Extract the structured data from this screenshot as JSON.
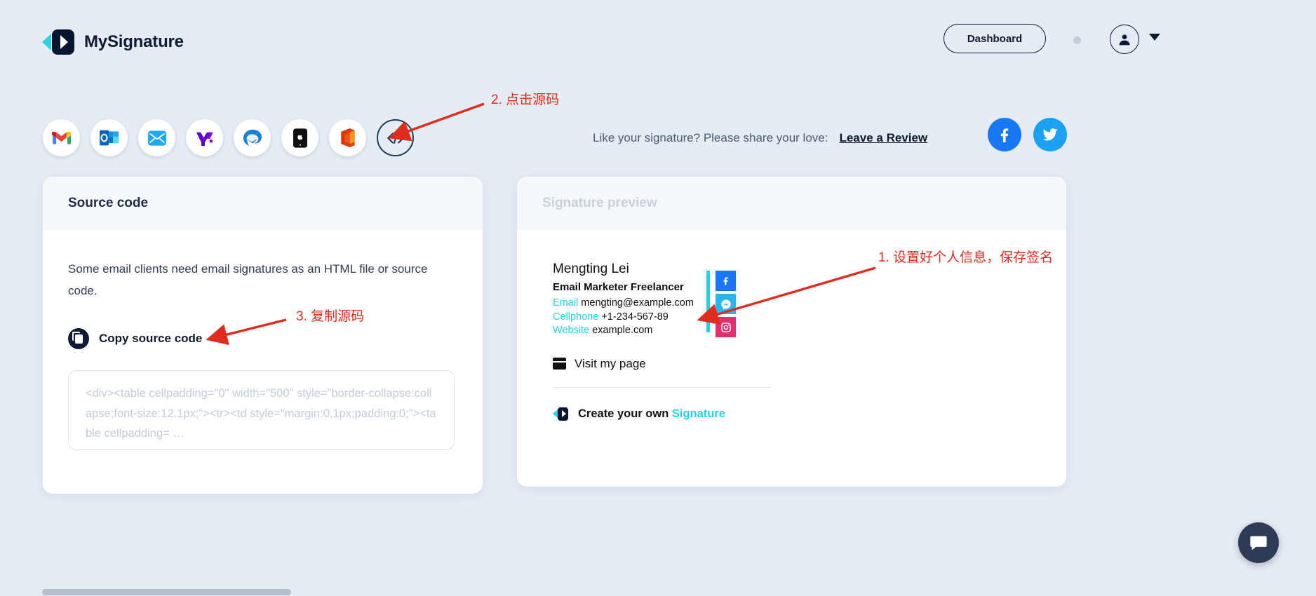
{
  "header": {
    "brand_name": "MySignature",
    "logo_icon": "mysignature-logo-icon",
    "dashboard_label": "Dashboard",
    "avatar_icon": "user-avatar-icon",
    "caret_icon": "chevron-down-icon",
    "status_dot_color": "#c6cedb"
  },
  "clients": [
    {
      "name": "gmail",
      "label": "Gmail",
      "selected": false
    },
    {
      "name": "outlook",
      "label": "Outlook",
      "selected": false
    },
    {
      "name": "apple-mail",
      "label": "Apple Mail",
      "selected": false
    },
    {
      "name": "yahoo-mail",
      "label": "Yahoo Mail",
      "selected": false
    },
    {
      "name": "thunderbird",
      "label": "Thunderbird",
      "selected": false
    },
    {
      "name": "iphone-mail",
      "label": "iPhone Mail",
      "selected": false
    },
    {
      "name": "office-365",
      "label": "Office 365",
      "selected": false
    },
    {
      "name": "source-code",
      "label": "Source code",
      "selected": true
    }
  ],
  "share": {
    "text": "Like your signature? Please share your love:",
    "link_label": "Leave a Review",
    "facebook_icon": "facebook-icon",
    "twitter_icon": "twitter-icon",
    "facebook_color": "#1877f2",
    "twitter_color": "#1da1f2"
  },
  "source_card": {
    "title": "Source code",
    "description": "Some email clients need email signatures as an HTML file or source code.",
    "copy_label": "Copy source code",
    "copy_icon": "copy-icon",
    "code": "<div><table cellpadding=\"0\" width=\"500\" style=\"border-collapse:collapse;font-size:12.1px;\"><tr><td style=\"margin:0.1px;padding:0;\"><table cellpadding= …"
  },
  "preview_card": {
    "title": "Signature preview",
    "signature": {
      "name": "Mengting Lei",
      "job_title": "Email Marketer Freelancer",
      "fields": [
        {
          "label": "Email",
          "value": "mengting@example.com"
        },
        {
          "label": "Cellphone",
          "value": "+1-234-567-89"
        },
        {
          "label": "Website",
          "value": "example.com"
        }
      ],
      "accent_color": "#22d3e6",
      "socials": [
        {
          "name": "facebook",
          "icon": "facebook-icon",
          "color": "#1877f2"
        },
        {
          "name": "messenger",
          "icon": "messenger-icon",
          "color": "#29b5ea"
        },
        {
          "name": "instagram",
          "icon": "instagram-icon",
          "color": "#e1306c"
        }
      ],
      "visit_label": "Visit my page",
      "visit_icon": "browser-window-icon",
      "create_prefix": "Create your own",
      "create_highlight": "Signature"
    }
  },
  "annotations": [
    {
      "id": "ann1",
      "text": "1. 设置好个人信息，保存签名",
      "color": "#e02b1d"
    },
    {
      "id": "ann2",
      "text": "2. 点击源码",
      "color": "#e02b1d"
    },
    {
      "id": "ann3",
      "text": "3. 复制源码",
      "color": "#e02b1d"
    }
  ],
  "chat": {
    "icon": "chat-bubble-icon",
    "color": "#2f3a54"
  }
}
